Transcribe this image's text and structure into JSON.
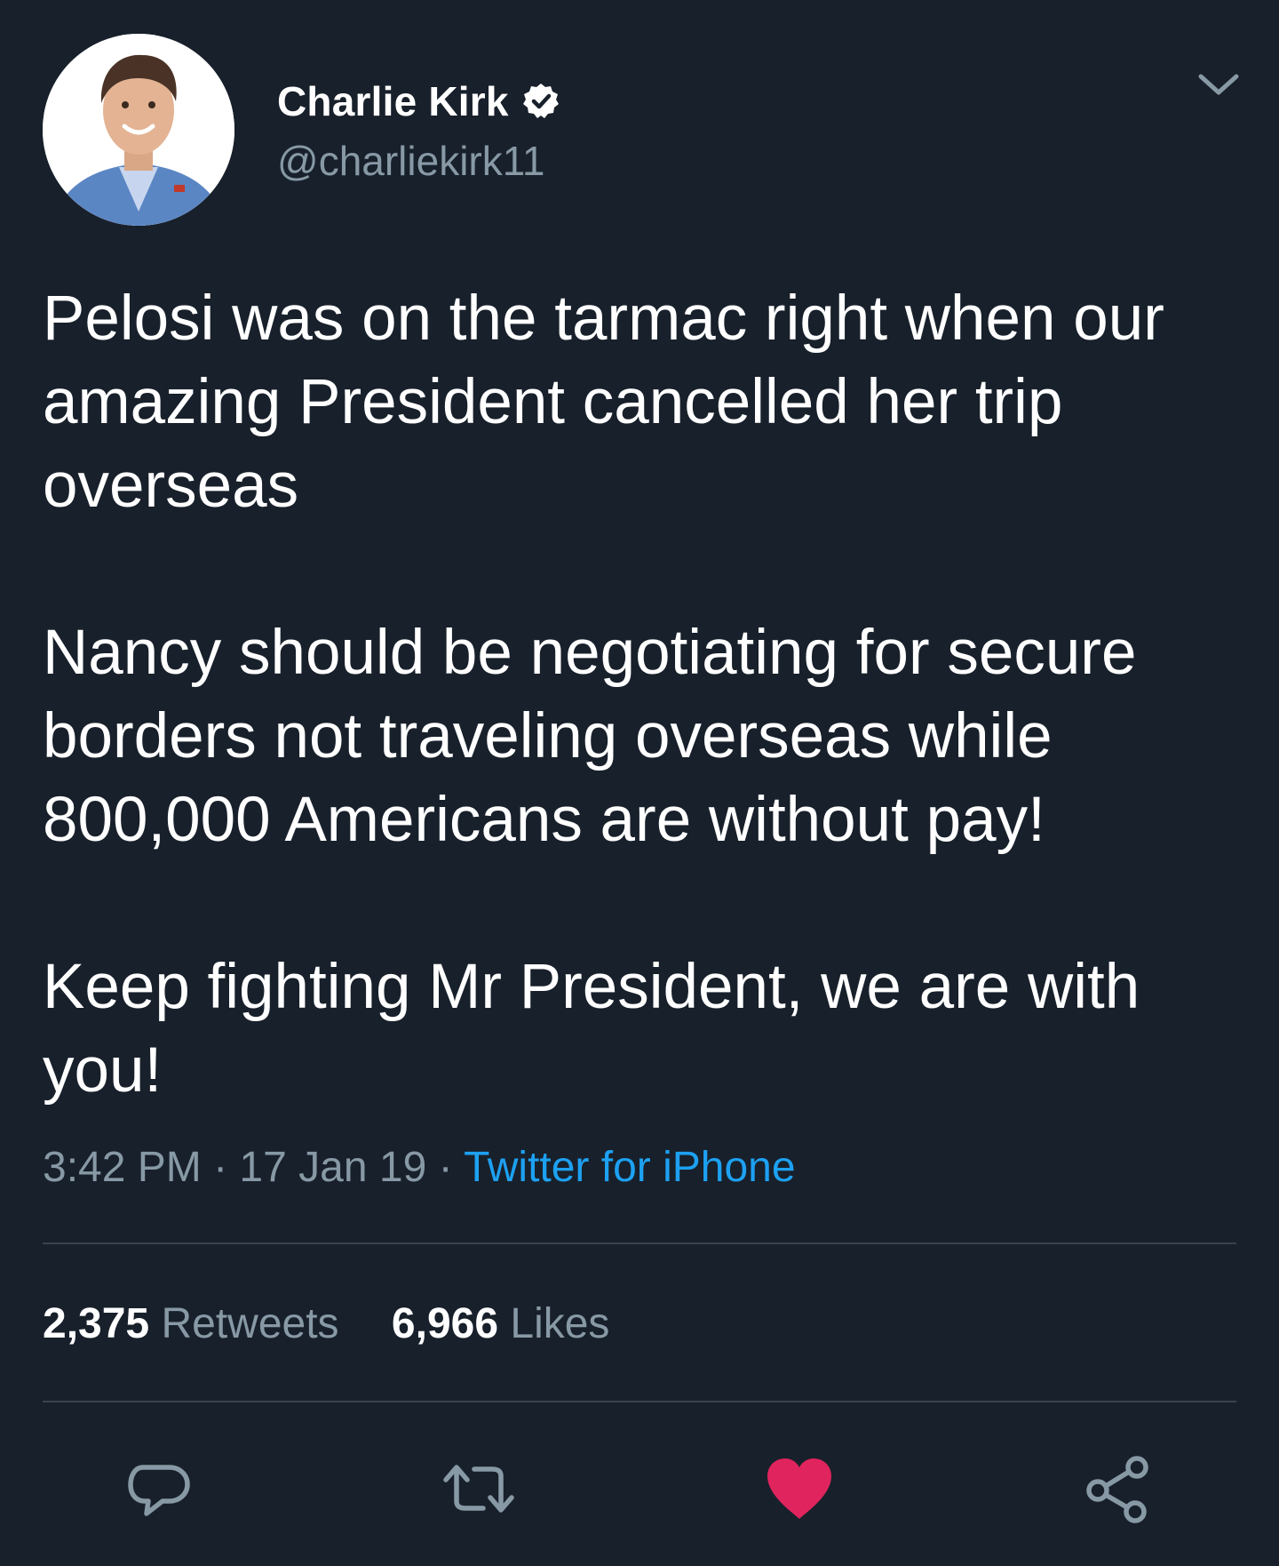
{
  "author": {
    "display_name": "Charlie Kirk",
    "handle": "@charliekirk11",
    "verified": true,
    "avatar_icon": "profile-photo"
  },
  "tweet": {
    "paragraphs": [
      "Pelosi was on the tarmac right when our amazing President cancelled her trip overseas",
      "Nancy should be negotiating for secure borders not traveling overseas while 800,000 Americans are without pay!",
      "Keep fighting Mr President, we are with you!"
    ],
    "time": "3:42 PM",
    "separator": " · ",
    "date": "17 Jan 19",
    "source": "Twitter for iPhone"
  },
  "stats": {
    "retweets_count": "2,375",
    "retweets_label": "Retweets",
    "likes_count": "6,966",
    "likes_label": "Likes"
  },
  "actions": {
    "reply_icon": "reply-icon",
    "retweet_icon": "retweet-icon",
    "like_icon": "heart-icon",
    "share_icon": "share-icon",
    "liked": true
  },
  "colors": {
    "background": "#18202b",
    "text": "#ffffff",
    "secondary_text": "#8899a6",
    "link": "#1da1f2",
    "like_active": "#e0245e",
    "divider": "#38444d"
  }
}
